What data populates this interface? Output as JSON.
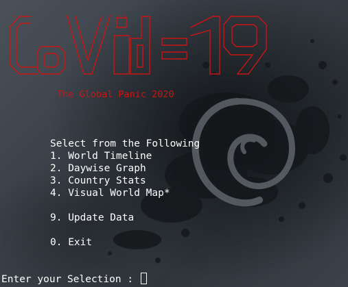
{
  "banner": {
    "title": "Covid-19",
    "tagline": "The Global Panic 2020",
    "accent_color": "#cc1414"
  },
  "menu": {
    "heading": "Select from the Following",
    "items": [
      "1. World Timeline",
      "2. Daywise Graph",
      "3. Country Stats",
      "4. Visual World Map*",
      "9. Update Data",
      "0. Exit"
    ]
  },
  "prompt": {
    "label": "Enter your Selection : ",
    "value": ""
  },
  "background": {
    "wallpaper": "debian-swirl-logo"
  }
}
